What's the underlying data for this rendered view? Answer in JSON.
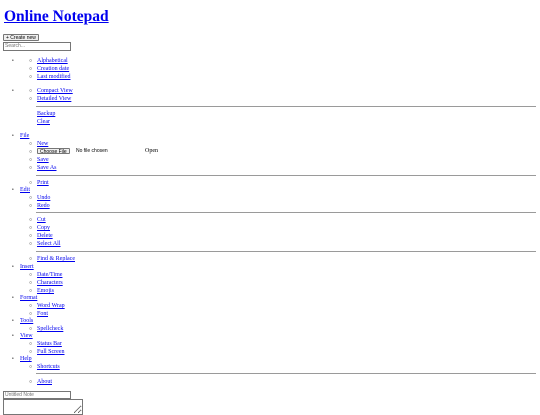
{
  "app": {
    "title": "Online Notepad"
  },
  "toolbar": {
    "create_new_label": "+ Create new",
    "search_placeholder": "Search..."
  },
  "bullets": {
    "disc": "•",
    "circle": "○"
  },
  "sort_options": [
    "Alphabetical",
    "Creation date",
    "Last modified"
  ],
  "view_modes": [
    "Compact View",
    "Detailed View"
  ],
  "storage_options": [
    "Backup",
    "Clear"
  ],
  "menu": {
    "file": {
      "label": "File",
      "new": "New",
      "choose_file": "Choose File",
      "no_file": "No file chosen",
      "open": "Open",
      "save": "Save",
      "save_as": "Save As",
      "print": "Print"
    },
    "edit": {
      "label": "Edit",
      "undo": "Undo",
      "redo": "Redo",
      "cut": "Cut",
      "copy": "Copy",
      "delete": "Delete",
      "select_all": "Select All",
      "find_replace": "Find & Replace"
    },
    "insert": {
      "label": "Insert",
      "datetime": "Date/Time",
      "characters": "Characters",
      "emojis": "Emojis"
    },
    "format": {
      "label": "Format",
      "word_wrap": "Word Wrap",
      "font": "Font"
    },
    "tools": {
      "label": "Tools",
      "spellcheck": "Spellcheck"
    },
    "view": {
      "label": "View",
      "status_bar": "Status Bar",
      "full_screen": "Full Screen"
    },
    "help": {
      "label": "Help",
      "shortcuts": "Shortcuts",
      "about": "About"
    }
  },
  "editor": {
    "note_name_placeholder": "Untitled Note"
  }
}
